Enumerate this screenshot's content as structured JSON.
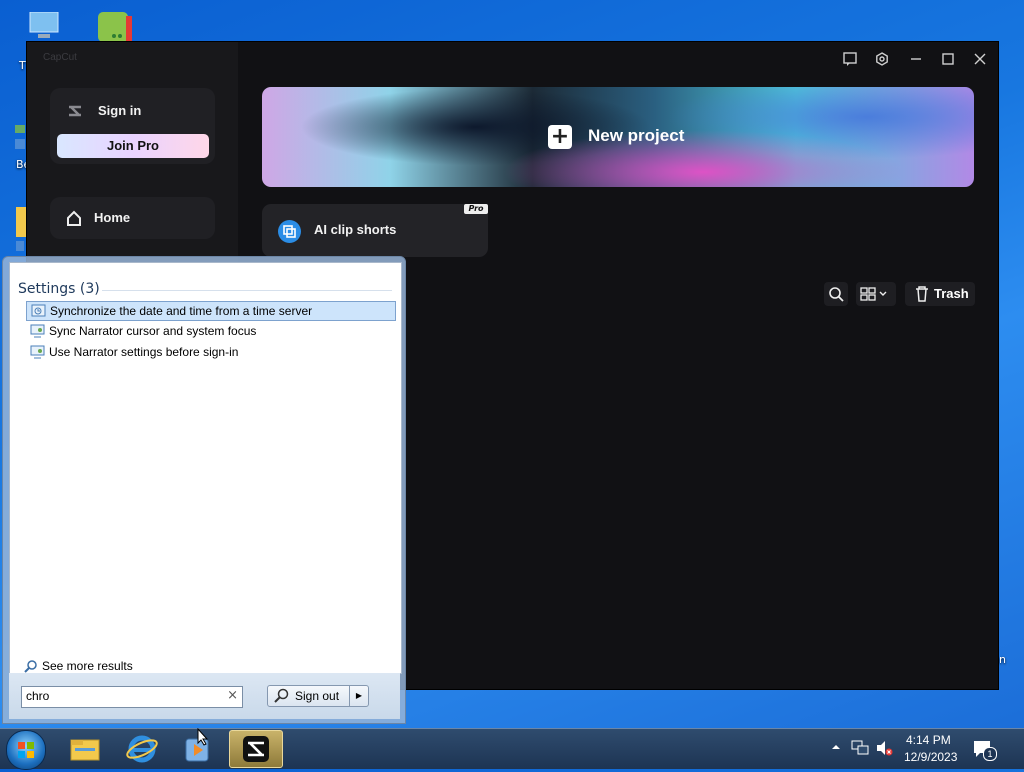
{
  "desktop": {
    "icon_labels": [
      "T",
      "Be",
      "n"
    ]
  },
  "capcut": {
    "app_title": "CapCut",
    "sidebar": {
      "sign_in_label": "Sign in",
      "join_pro_label": "Join Pro",
      "home_label": "Home"
    },
    "new_project_label": "New project",
    "ai_clip_label": "AI clip shorts",
    "pro_badge": "Pro",
    "trash_label": "Trash"
  },
  "start_menu": {
    "category_label": "Settings (3)",
    "results": [
      {
        "label": "Synchronize the date and time from a time server",
        "selected": true
      },
      {
        "label": "Sync Narrator cursor and system focus",
        "selected": false
      },
      {
        "label": "Use Narrator settings before sign-in",
        "selected": false
      }
    ],
    "see_more_label": "See more results",
    "search_value": "chro",
    "sign_out_label": "Sign out"
  },
  "taskbar": {
    "time": "4:14 PM",
    "date": "12/9/2023",
    "notification_count": "1"
  }
}
